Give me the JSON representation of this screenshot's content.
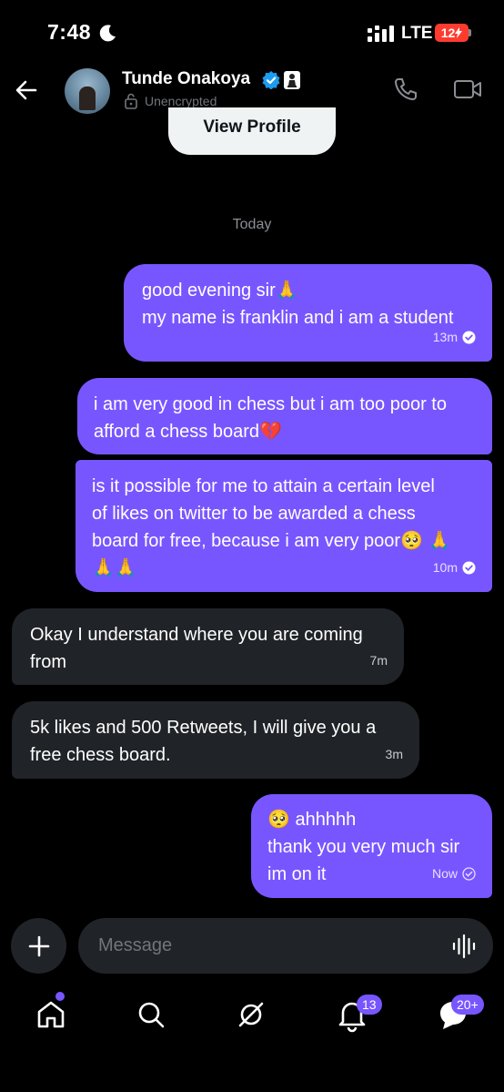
{
  "status_bar": {
    "time": "7:48",
    "network": "LTE",
    "battery": "12"
  },
  "header": {
    "name": "Tunde Onakoya",
    "encryption_status": "Unencrypted"
  },
  "view_profile_label": "View Profile",
  "date_separator": "Today",
  "messages": [
    {
      "direction": "sent",
      "text": "good evening sir🙏\nmy name is franklin and i am a student",
      "time": "13m"
    },
    {
      "direction": "sent",
      "text": "i am very good in chess but i am too poor to\nafford a chess board💔",
      "time": ""
    },
    {
      "direction": "sent",
      "text": "is it possible for me to attain a certain level\nof likes on twitter to be awarded a chess\nboard for free, because i am very poor🥺 🙏\n🙏🙏",
      "time": "10m"
    },
    {
      "direction": "received",
      "text": "Okay I understand where you are coming\nfrom",
      "time": "7m"
    },
    {
      "direction": "received",
      "text": "5k likes and 500 Retweets, I will give you a\nfree chess board.",
      "time": "3m"
    },
    {
      "direction": "sent",
      "text": "🥺 ahhhhh\nthank you very much sir\nim on it",
      "time": "Now"
    }
  ],
  "composer": {
    "placeholder": "Message"
  },
  "bottom_nav": {
    "notifications_badge": "13",
    "messages_badge": "20+"
  },
  "colors": {
    "accent": "#7856ff",
    "received_bubble": "#202327",
    "background": "#000000",
    "verified": "#1d9bf0",
    "battery": "#ff3b30"
  }
}
